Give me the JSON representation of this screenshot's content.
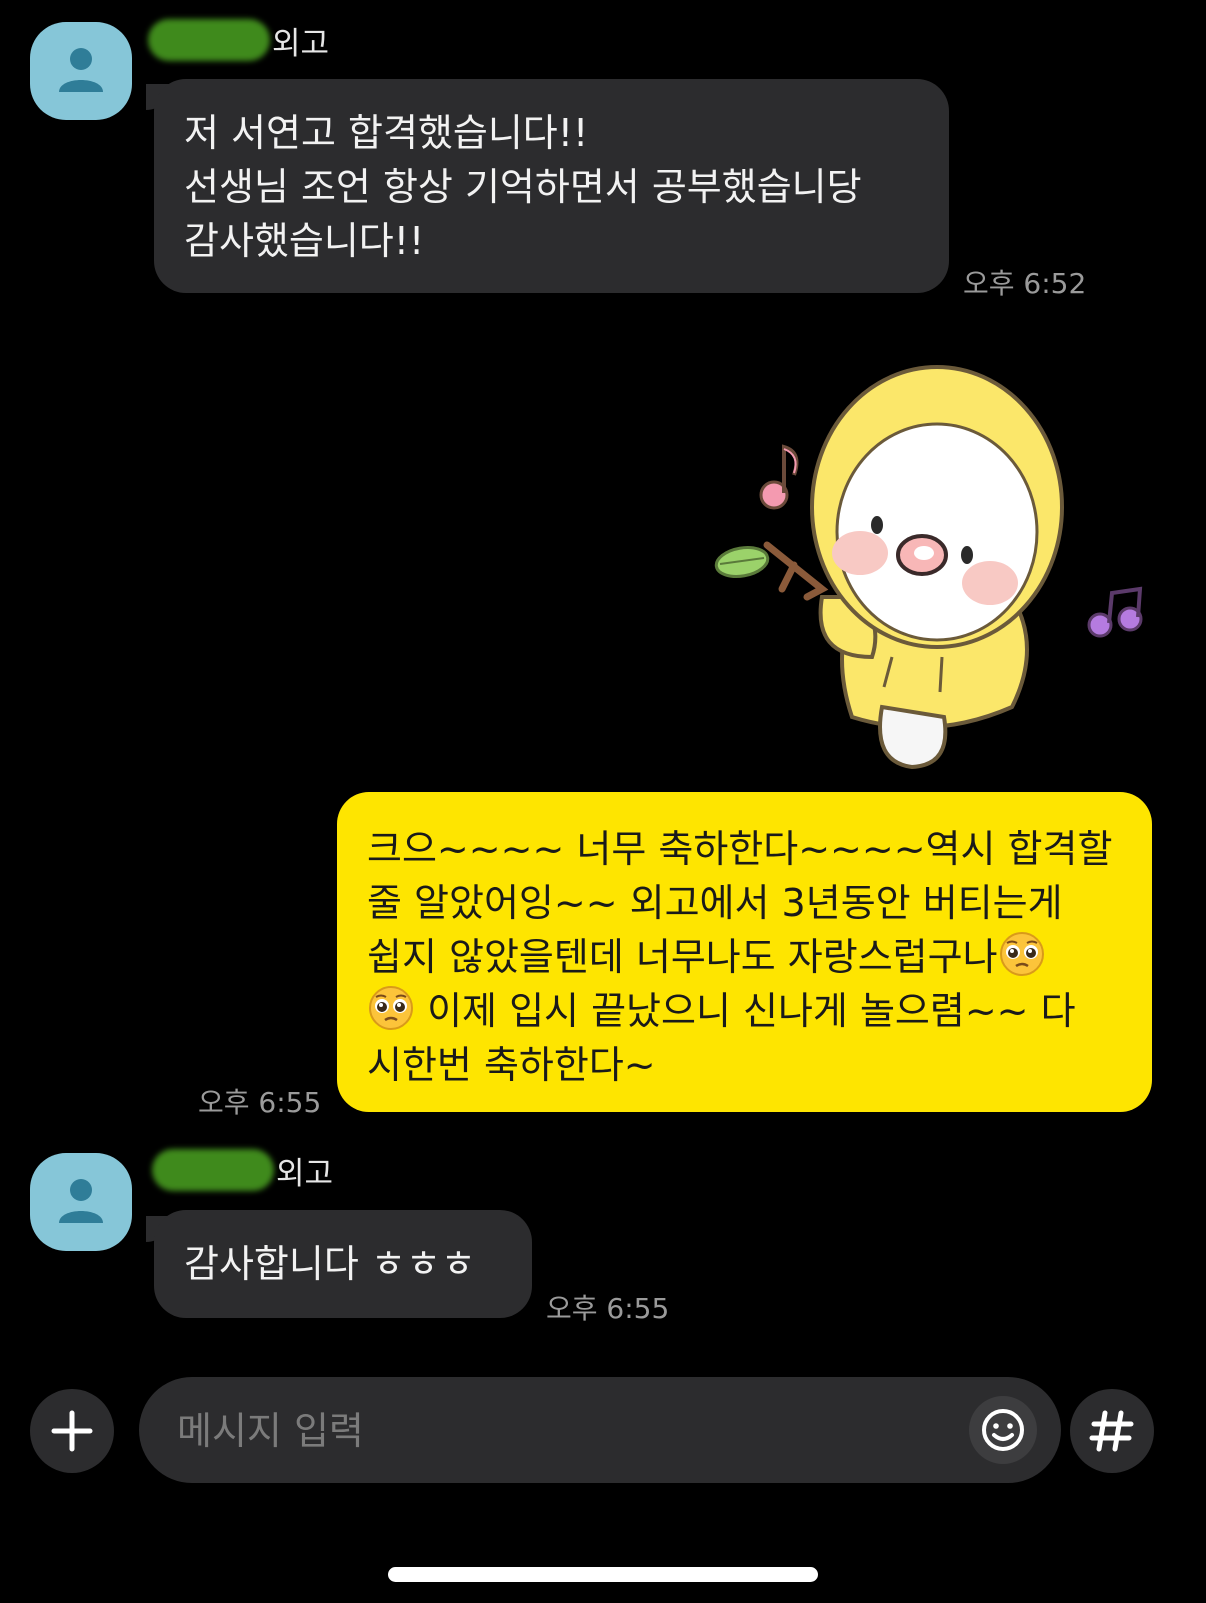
{
  "messages": [
    {
      "direction": "incoming",
      "sender_suffix": "외고",
      "text": "저 서연고 합격했습니다!!\n선생님 조언 항상 기억하면서 공부했습니당\n감사했습니다!!",
      "time": "오후 6:52"
    },
    {
      "direction": "outgoing",
      "type": "sticker",
      "sticker": "yellow-hood-character-sticker"
    },
    {
      "direction": "outgoing",
      "text_before": "크으~~~~ 너무 축하한다~~~~역시 합격할\n줄 알았어잉~~ 외고에서 3년동안 버티는게\n쉽지 않았을텐데 너무나도 자랑스럽구나",
      "emoji": "pleading-face-emoji",
      "text_after": " 이제 입시 끝났으니 신나게 놀으렴~~ 다\n시한번 축하한다~",
      "time": "오후 6:55"
    },
    {
      "direction": "incoming",
      "sender_suffix": "외고",
      "text": "감사합니다 ㅎㅎㅎ",
      "time": "오후 6:55"
    }
  ],
  "input": {
    "placeholder": "메시지 입력"
  },
  "icons": {
    "plus": "plus-icon",
    "emoji": "emoji-icon",
    "hash": "hash-icon",
    "avatar": "default-profile-icon"
  },
  "colors": {
    "background": "#000000",
    "incoming_bubble": "#2c2c2e",
    "outgoing_bubble": "#fee500",
    "avatar": "#86c6d8",
    "name_redaction": "#3f8a1c"
  }
}
